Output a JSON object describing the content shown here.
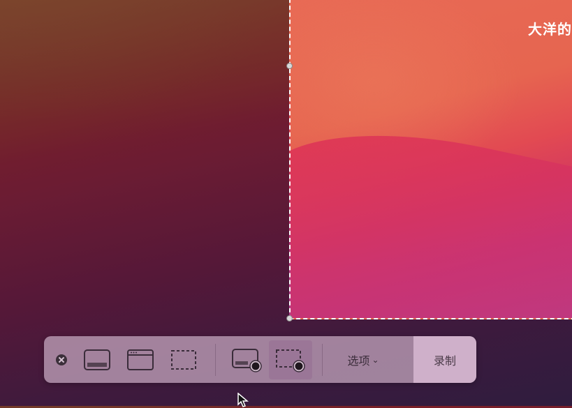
{
  "watermark": {
    "text": "大洋的"
  },
  "toolbar": {
    "close_icon": "close-icon",
    "capture_entire_screen_icon": "screen-capture-icon",
    "capture_window_icon": "window-capture-icon",
    "capture_selection_icon": "selection-capture-icon",
    "record_entire_screen_icon": "screen-record-icon",
    "record_selection_icon": "selection-record-icon",
    "options_label": "选项",
    "options_chevron": "⌄",
    "record_label": "录制"
  },
  "colors": {
    "selection_border": "#ffffff",
    "toolbar_bg": "#bea0b9",
    "icon_stroke": "#3a2c3a"
  }
}
